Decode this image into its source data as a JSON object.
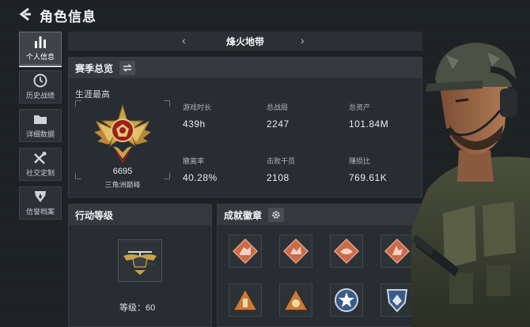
{
  "header": {
    "title": "角色信息"
  },
  "sidebar": {
    "items": [
      {
        "label": "个人信息",
        "icon": "bar-chart-icon",
        "active": true
      },
      {
        "label": "历史战绩",
        "icon": "clock-icon",
        "active": false
      },
      {
        "label": "详细数据",
        "icon": "folder-icon",
        "active": false
      },
      {
        "label": "社交定制",
        "icon": "tools-icon",
        "active": false
      },
      {
        "label": "信誉档案",
        "icon": "shield-icon",
        "active": false
      }
    ]
  },
  "map_selector": {
    "name": "烽火地带",
    "prev_icon": "chevron-left-icon",
    "next_icon": "chevron-right-icon"
  },
  "season": {
    "title": "赛季总览",
    "switch_icon": "swap-icon",
    "career_label": "生涯最高",
    "rank_score": "6695",
    "rank_name": "三角洲巅峰",
    "stats": [
      {
        "label": "游戏时长",
        "value": "439h"
      },
      {
        "label": "总战局",
        "value": "2247"
      },
      {
        "label": "总资产",
        "value": "101.84M"
      },
      {
        "label": "撤离率",
        "value": "40.28%"
      },
      {
        "label": "击败干员",
        "value": "2108"
      },
      {
        "label": "赚损比",
        "value": "769.61K"
      }
    ]
  },
  "action_level": {
    "title": "行动等级",
    "level_text": "等级：60"
  },
  "badges": {
    "title": "成就徽章",
    "settings_icon": "gear-icon",
    "items": [
      {
        "icon": "diamond-badge-icon",
        "color": "#c96a4a"
      },
      {
        "icon": "diamond-badge-icon",
        "color": "#c96a4a"
      },
      {
        "icon": "diamond-badge-icon",
        "color": "#c96a4a"
      },
      {
        "icon": "diamond-badge-icon",
        "color": "#c96a4a"
      },
      {
        "icon": "triangle-badge-icon",
        "color": "#c97a3a"
      },
      {
        "icon": "triangle-badge-icon",
        "color": "#c97a3a"
      },
      {
        "icon": "star-badge-icon",
        "color": "#3a5a8a"
      },
      {
        "icon": "crest-badge-icon",
        "color": "#3a5a8a"
      }
    ]
  },
  "colors": {
    "accent": "#d9dde0",
    "background": "#1c2124",
    "panel": "#282f33",
    "gold": "#c9a247",
    "badge_red": "#c96a4a"
  }
}
